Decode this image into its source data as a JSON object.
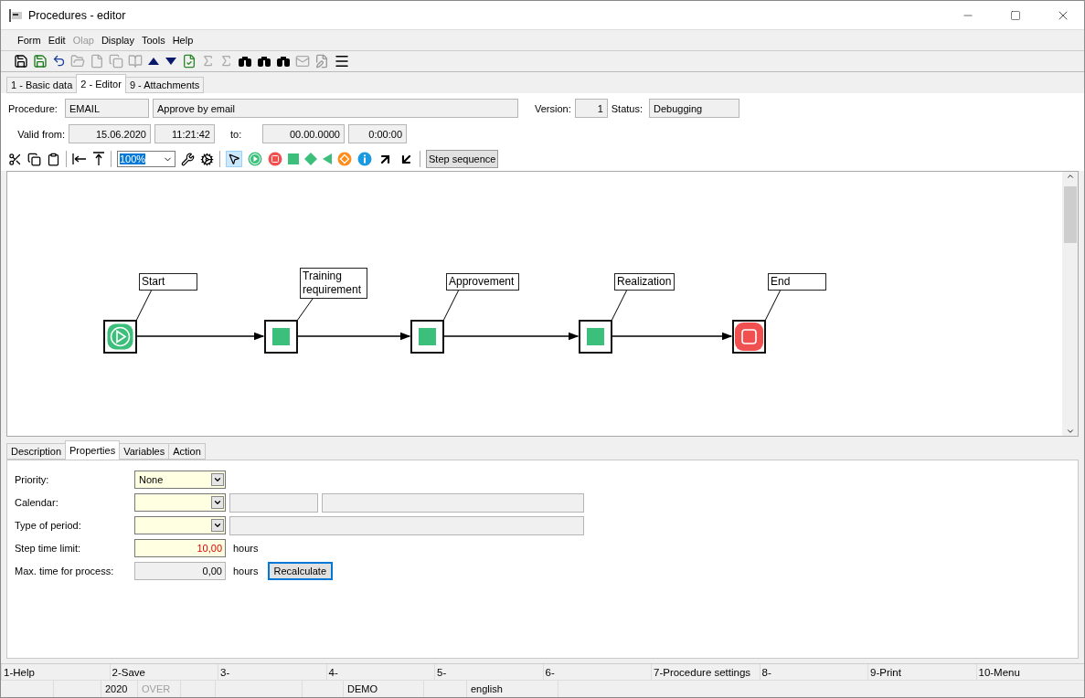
{
  "window": {
    "title": "Procedures - editor"
  },
  "menu": [
    {
      "label": "Form",
      "disabled": false
    },
    {
      "label": "Edit",
      "disabled": false
    },
    {
      "label": "Olap",
      "disabled": true
    },
    {
      "label": "Display",
      "disabled": false
    },
    {
      "label": "Tools",
      "disabled": false
    },
    {
      "label": "Help",
      "disabled": false
    }
  ],
  "tabs": [
    {
      "label": "1 - Basic data",
      "selected": false
    },
    {
      "label": "2 - Editor",
      "selected": true
    },
    {
      "label": "9 - Attachments",
      "selected": false
    }
  ],
  "header": {
    "procedure_label": "Procedure:",
    "procedure_code": "EMAIL",
    "procedure_name": "Approve by email",
    "version_label": "Version:",
    "version": "1",
    "status_label": "Status:",
    "status": "Debugging",
    "valid_from_label": "Valid from:",
    "valid_from_date": "15.06.2020",
    "valid_from_time": "11:21:42",
    "to_label": "to:",
    "to_date": "00.00.0000",
    "to_time": "0:00:00"
  },
  "editor_toolbar": {
    "zoom": "100%",
    "step_sequence": "Step sequence"
  },
  "diagram": {
    "nodes": [
      {
        "kind": "start",
        "label": "Start"
      },
      {
        "kind": "step",
        "label": "Training requirement"
      },
      {
        "kind": "step",
        "label": "Approvement"
      },
      {
        "kind": "step",
        "label": "Realization"
      },
      {
        "kind": "end",
        "label": "End"
      }
    ]
  },
  "bottom_tabs": [
    {
      "label": "Description",
      "selected": false
    },
    {
      "label": "Properties",
      "selected": true
    },
    {
      "label": "Variables",
      "selected": false
    },
    {
      "label": "Action",
      "selected": false
    }
  ],
  "properties": [
    {
      "kind": "select",
      "label": "Priority:",
      "value": "None"
    },
    {
      "kind": "select-code-name",
      "label": "Calendar:"
    },
    {
      "kind": "select-name",
      "label": "Type of period:"
    },
    {
      "kind": "input",
      "label": "Step time limit:",
      "value": "10,00",
      "warning": true,
      "unit": "hours"
    },
    {
      "kind": "readonly",
      "label": "Max. time for process:",
      "value": "0,00",
      "warning": false,
      "unit": "hours",
      "button": "Recalculate"
    }
  ],
  "function_keys": [
    "1-Help",
    "2-Save",
    "3-",
    "4-",
    "5-",
    "6-",
    "7-Procedure settings",
    "8-",
    "9-Print",
    "10-Menu"
  ],
  "status_bar": [
    {
      "kind": "empty"
    },
    {
      "kind": "empty"
    },
    {
      "kind": "text",
      "text": "2020",
      "disabled": false
    },
    {
      "kind": "text",
      "text": "OVER",
      "disabled": true
    },
    {
      "kind": "empty"
    },
    {
      "kind": "empty"
    },
    {
      "kind": "empty"
    },
    {
      "kind": "text",
      "text": "DEMO",
      "disabled": false
    },
    {
      "kind": "empty"
    },
    {
      "kind": "text",
      "text": "english",
      "disabled": false
    },
    {
      "kind": "fill"
    }
  ]
}
